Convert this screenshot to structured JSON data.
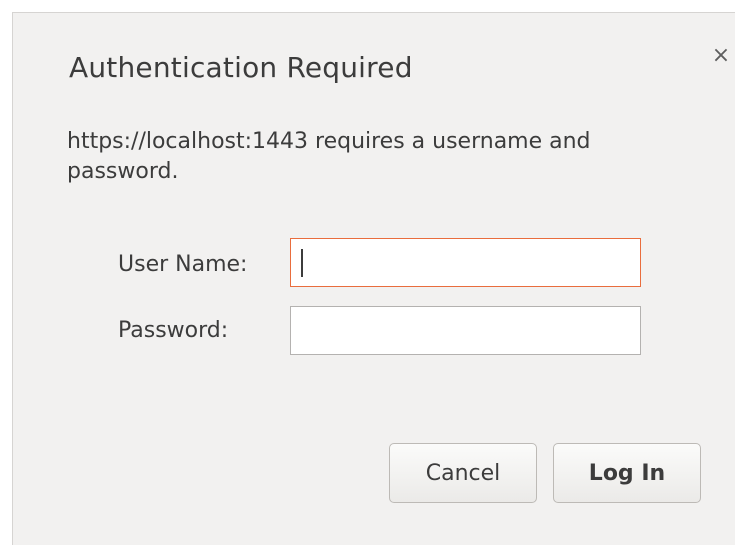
{
  "dialog": {
    "title": "Authentication Required",
    "message": "https://localhost:1443 requires a username and password.",
    "close_glyph": "×",
    "close_icon": "close-icon"
  },
  "form": {
    "username_label": "User Name:",
    "username_value": "",
    "password_label": "Password:",
    "password_value": ""
  },
  "buttons": {
    "cancel_label": "Cancel",
    "login_label": "Log In"
  },
  "colors": {
    "focus_border": "#e96d3d",
    "dialog_bg": "#f2f1f0",
    "text": "#3c3c3c"
  }
}
